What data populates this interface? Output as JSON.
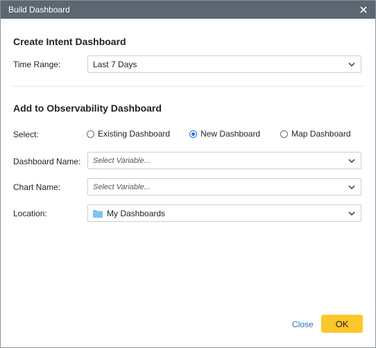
{
  "dialog": {
    "title": "Build Dashboard"
  },
  "intent": {
    "heading": "Create Intent Dashboard",
    "time_range_label": "Time Range:",
    "time_range_value": "Last 7 Days"
  },
  "observability": {
    "heading": "Add to Observability Dashboard",
    "select_label": "Select:",
    "options": [
      "Existing Dashboard",
      "New Dashboard",
      "Map Dashboard"
    ],
    "selected_option": "New Dashboard",
    "dashboard_name_label": "Dashboard Name:",
    "dashboard_name_placeholder": "Select Variable...",
    "chart_name_label": "Chart Name:",
    "chart_name_placeholder": "Select Variable...",
    "location_label": "Location:",
    "location_value": "My Dashboards"
  },
  "footer": {
    "close_label": "Close",
    "ok_label": "OK"
  },
  "colors": {
    "titlebar": "#5c6772",
    "ok_button": "#fcc72a",
    "link": "#1d6fb8",
    "radio_selected": "#1a73e8",
    "folder": "#7ec3ee"
  }
}
